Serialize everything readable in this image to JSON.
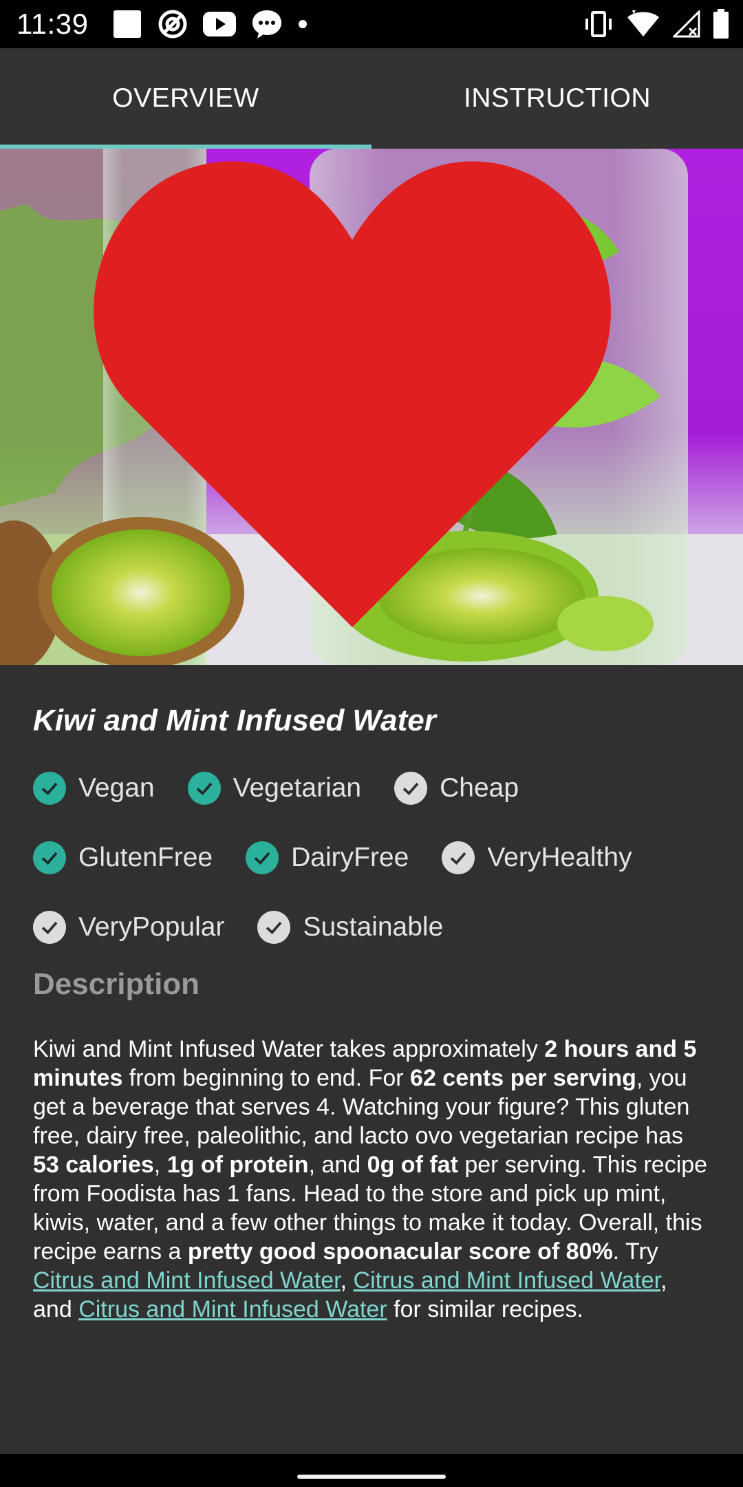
{
  "status_bar": {
    "time": "11:39",
    "left_icons": [
      "gallery-icon",
      "vpn-icon",
      "youtube-icon",
      "chat-bubble-icon",
      "dot-icon"
    ],
    "right_icons": [
      "vibrate-icon",
      "wifi-icon",
      "signal-icon",
      "battery-icon"
    ]
  },
  "tabs": [
    {
      "label": "OVERVIEW",
      "active": true
    },
    {
      "label": "INSTRUCTION",
      "active": false
    }
  ],
  "hero": {
    "image": "kiwi-mint-water-photo",
    "favorite": true,
    "favorite_color": "#e02020"
  },
  "recipe": {
    "title": "Kiwi and Mint Infused Water",
    "tags": [
      {
        "label": "Vegan",
        "checked": true
      },
      {
        "label": "Vegetarian",
        "checked": true
      },
      {
        "label": "Cheap",
        "checked": false
      },
      {
        "label": "GlutenFree",
        "checked": true
      },
      {
        "label": "DairyFree",
        "checked": true
      },
      {
        "label": "VeryHealthy",
        "checked": false
      },
      {
        "label": "VeryPopular",
        "checked": false
      },
      {
        "label": "Sustainable",
        "checked": false
      }
    ],
    "description_heading": "Description",
    "description": {
      "s1": "Kiwi and Mint Infused Water takes approximately ",
      "b1": "2 hours and 5 minutes",
      "s2": " from beginning to end. For ",
      "b2": "62 cents per serving",
      "s3": ", you get a beverage that serves 4. Watching your figure? This gluten free, dairy free, paleolithic, and lacto ovo vegetarian recipe has ",
      "b3": "53 calories",
      "s4": ", ",
      "b4": "1g of protein",
      "s5": ", and ",
      "b5": "0g of fat",
      "s6": " per serving. This recipe from Foodista has 1 fans. Head to the store and pick up mint, kiwis, water, and a few other things to make it today. Overall, this recipe earns a ",
      "b6": "pretty good spoonacular score of 80%",
      "s7": ". Try ",
      "link1": "Citrus and Mint Infused Water",
      "s8": ", ",
      "link2": "Citrus and Mint Infused Water",
      "s9": ", and ",
      "link3": "Citrus and Mint Infused Water",
      "s10": " for similar recipes."
    }
  },
  "colors": {
    "accent": "#6fc9c4",
    "check_on": "#2ab09b",
    "check_off": "#dcdcdc",
    "link": "#7fd6ce",
    "surface": "#303030",
    "tab_bar": "#333333"
  }
}
